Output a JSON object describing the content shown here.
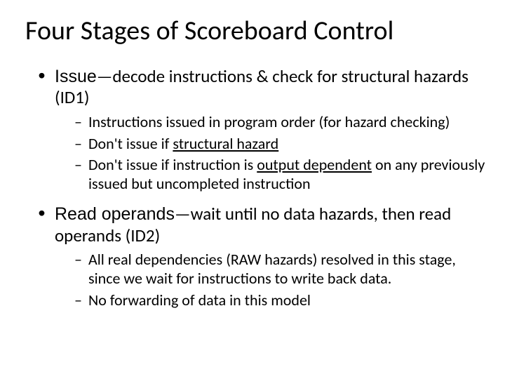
{
  "title": "Four Stages of Scoreboard Control",
  "bullets": [
    {
      "stage": "Issue",
      "rest": "—decode instructions & check for structural hazards (ID1)",
      "sub": [
        {
          "pre": "Instructions issued in program order (for hazard checking)",
          "u": "",
          "post": ""
        },
        {
          "pre": "Don't issue if ",
          "u": "structural hazard",
          "post": ""
        },
        {
          "pre": "Don't issue if instruction is ",
          "u": "output dependent",
          "post": " on any previously issued but uncompleted instruction"
        }
      ]
    },
    {
      "stage": "Read operands",
      "rest": "—wait until no data hazards, then read operands (ID2)",
      "sub": [
        {
          "pre": " All real dependencies (RAW hazards) resolved in this stage, since we wait for instructions to write back data.",
          "u": "",
          "post": ""
        },
        {
          "pre": "No forwarding of data in this model",
          "u": "",
          "post": ""
        }
      ]
    }
  ]
}
